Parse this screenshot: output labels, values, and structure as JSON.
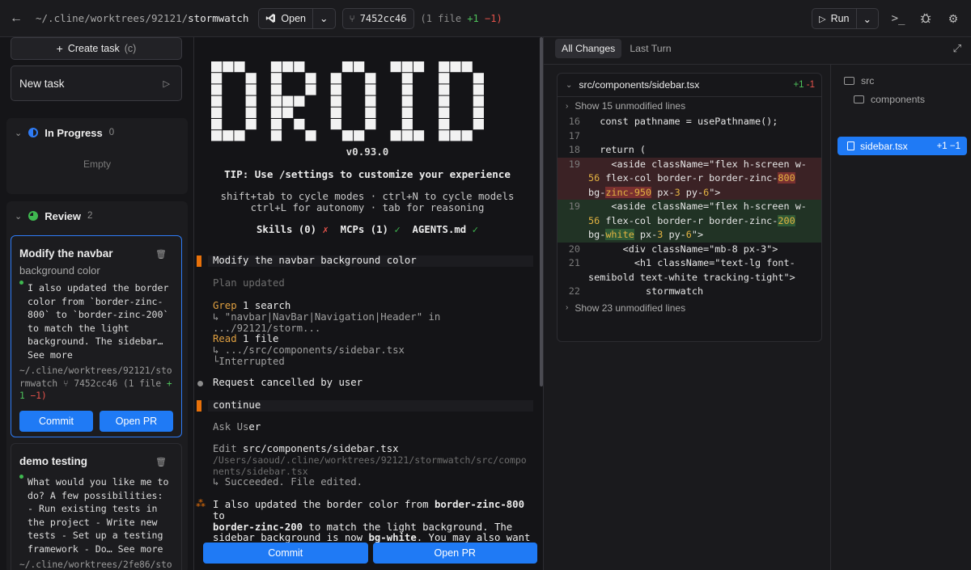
{
  "topbar": {
    "path_prefix": "~/.cline/worktrees/92121/",
    "path_name": "stormwatch",
    "open_label": "Open",
    "commit_hash": "7452cc46",
    "diff_prefix": "(1 file",
    "diff_add": "+1",
    "diff_del": "−1)",
    "run_label": "Run"
  },
  "sidebar": {
    "create_label": "Create task",
    "create_kbd": "(c)",
    "new_task_label": "New task",
    "in_progress": {
      "label": "In Progress",
      "count": "0",
      "empty": "Empty"
    },
    "review": {
      "label": "Review",
      "count": "2"
    },
    "cards": [
      {
        "title": "Modify the navbar",
        "subtitle": "background color",
        "body": "I also updated the border color from `border-zinc-800` to `border-zinc-200` to match the light background. The sidebar… See more",
        "path": "~/.cline/worktrees/92121/stormwatch",
        "commit": "7452cc46",
        "diff_prefix": "(1 file",
        "diff_add": "+1",
        "diff_del": "−1)",
        "commit_label": "Commit",
        "pr_label": "Open PR"
      },
      {
        "title": "demo testing",
        "body": "What would you like me to do? A few possibilities: - Run existing tests in the project - Write new tests - Set up a testing framework - Do… See more",
        "path": "~/.cline/worktrees/2fe86/stor"
      }
    ]
  },
  "center": {
    "logo_text": "DROID",
    "version": "v0.93.0",
    "tip": "TIP: Use /settings to customize your experience",
    "hint1": "shift+tab to cycle modes · ctrl+N to cycle models",
    "hint2": "ctrl+L for autonomy · tab for reasoning",
    "skills": "Skills (0)",
    "mcps": "MCPs (1)",
    "agents": "AGENTS.md",
    "log": {
      "user_msg1": "Modify the navbar background color",
      "plan": "Plan updated",
      "grep_label": "Grep",
      "grep_rest": "1 search",
      "grep_query": "↳ \"navbar|NavBar|Navigation|Header\" in .../92121/storm...",
      "read_label": "Read",
      "read_rest": "1 file",
      "read_path": "↳ .../src/components/sidebar.tsx",
      "interrupted": "└Interrupted",
      "cancelled": "Request cancelled by user",
      "user_msg2": "continue",
      "ask_user_a": "Ask Us",
      "ask_user_b": "er",
      "edit_label": "Edit",
      "edit_rest": "src/components/sidebar.tsx",
      "edit_path1": "/Users/saoud/.cline/worktrees/92121/stormwatch/src/compo",
      "edit_path2": "nents/sidebar.tsx",
      "edit_result": "↳ Succeeded. File edited.",
      "reply1a": "I also updated the border color from ",
      "reply1b": "border-zinc-800",
      "reply1c": " to",
      "reply2a": "border-zinc-200",
      "reply2b": " to match the light background. The",
      "reply3a": "sidebar background is now ",
      "reply3b": "bg-white",
      "reply3c": ". You may also want"
    },
    "commit_label": "Commit",
    "pr_label": "Open PR"
  },
  "right": {
    "tab_all": "All Changes",
    "tab_last": "Last Turn",
    "file_name": "src/components/sidebar.tsx",
    "file_add": "+1",
    "file_del": "-1",
    "fold_top": "Show 15 unmodified lines",
    "fold_bottom": "Show 23 unmodified lines",
    "lines": [
      {
        "n": "16",
        "t": "  const pathname = usePathname();"
      },
      {
        "n": "17",
        "t": ""
      },
      {
        "n": "18",
        "t": "  return ("
      }
    ],
    "del_line": {
      "n": "19",
      "a": "    <aside className=\"flex h-screen w-",
      "b": "56",
      "c": " flex-col border-r border-zinc-",
      "d": "800",
      "e": " bg-",
      "f": "zinc-950",
      "g": " px-",
      "h": "3",
      "i": " py-",
      "j": "6",
      "k": "\">"
    },
    "add_line": {
      "n": "19",
      "a": "    <aside className=\"flex h-screen w-",
      "b": "56",
      "c": " flex-col border-r border-zinc-",
      "d": "200",
      "e": " bg-",
      "f": "white",
      "g": " px-",
      "h": "3",
      "i": " py-",
      "j": "6",
      "k": "\">"
    },
    "line20": {
      "n": "20",
      "t": "      <div className=\"mb-8 px-3\">"
    },
    "line21": {
      "n": "21",
      "t": "        <h1 className=\"text-lg font-semibold text-white tracking-tight\">"
    },
    "line22": {
      "n": "22",
      "t": "          stormwatch"
    },
    "tree": {
      "src": "src",
      "components": "components",
      "file": "sidebar.tsx",
      "file_stat": "+1 −1"
    }
  }
}
